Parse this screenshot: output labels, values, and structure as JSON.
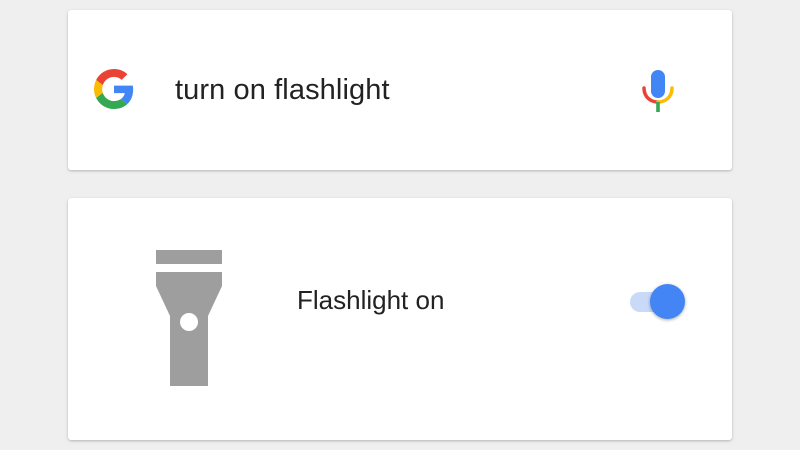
{
  "search": {
    "query": "turn on flashlight",
    "logo_icon": "google-g-logo",
    "mic_icon": "microphone-icon"
  },
  "flashlight": {
    "icon": "flashlight-icon",
    "label": "Flashlight on",
    "toggle_on": true
  },
  "colors": {
    "background": "#efefef",
    "card": "#ffffff",
    "toggle_knob": "#4385f4",
    "toggle_track": "#c9daf8",
    "flashlight_icon": "#9e9e9e",
    "google_blue": "#4285f4",
    "google_red": "#ea4335",
    "google_yellow": "#fbbc05",
    "google_green": "#34a853"
  }
}
